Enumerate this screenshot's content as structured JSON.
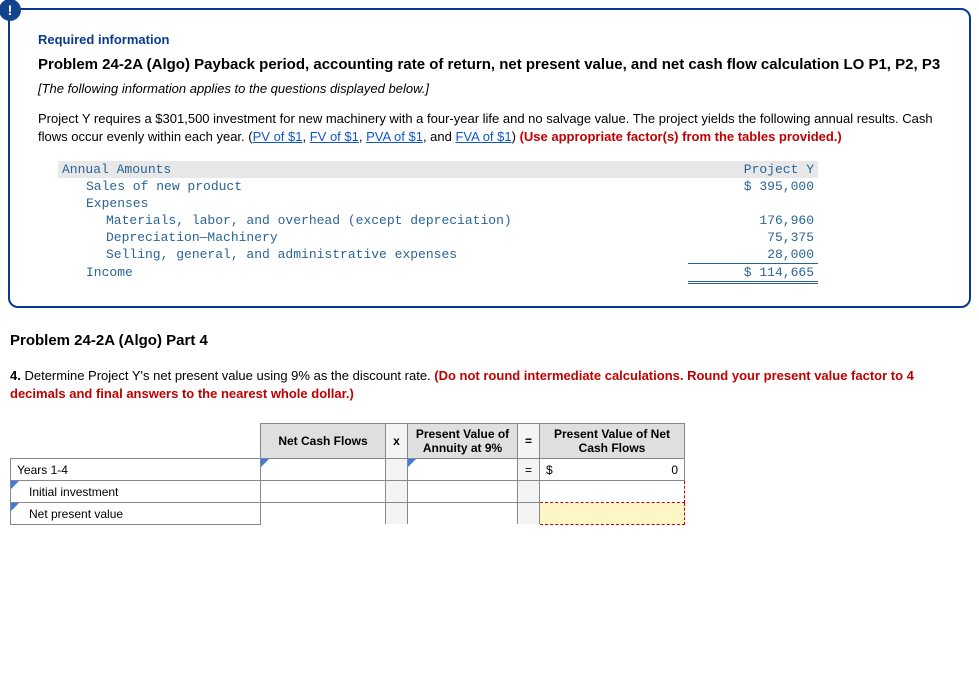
{
  "header": {
    "alert_char": "!",
    "required": "Required information",
    "title": "Problem 24-2A (Algo) Payback period, accounting rate of return, net present value, and net cash flow calculation LO P1, P2, P3",
    "applies_note": "[The following information applies to the questions displayed below.]",
    "body_pre": "Project Y requires a $301,500 investment for new machinery with a four-year life and no salvage value. The project yields the following annual results. Cash flows occur evenly within each year. (",
    "links": {
      "pv": "PV of $1",
      "fv": "FV of $1",
      "pva": "PVA of $1",
      "fva": "FVA of $1"
    },
    "sep": ", ",
    "and": ", and ",
    "close_paren": ") ",
    "use_factors": "(Use appropriate factor(s) from the tables provided.)"
  },
  "fin": {
    "hdr_label": "Annual Amounts",
    "hdr_val": "Project Y",
    "sales_label": "Sales of new product",
    "sales_val": "$ 395,000",
    "expenses_label": "Expenses",
    "mlo_label": "Materials, labor, and overhead (except depreciation)",
    "mlo_val": "176,960",
    "dep_label": "Depreciation—Machinery",
    "dep_val": "75,375",
    "sga_label": "Selling, general, and administrative expenses",
    "sga_val": "28,000",
    "income_label": "Income",
    "income_val": "$ 114,665"
  },
  "part4": {
    "title": "Problem 24-2A (Algo) Part 4",
    "q_num": "4. ",
    "q_text": "Determine Project Y's net present value using 9% as the discount rate. ",
    "q_red": "(Do not round intermediate calculations. Round your present value factor to 4 decimals and final answers to the nearest whole dollar.)"
  },
  "npv": {
    "col_ncf": "Net Cash Flows",
    "col_x": "x",
    "col_pva": "Present Value of Annuity at 9%",
    "col_eq": "=",
    "col_pvnet": "Present Value of Net Cash Flows",
    "row_years": "Years 1-4",
    "row_initial": "Initial investment",
    "row_npv": "Net present value",
    "eq": "=",
    "dollar": "$",
    "zero": "0"
  }
}
